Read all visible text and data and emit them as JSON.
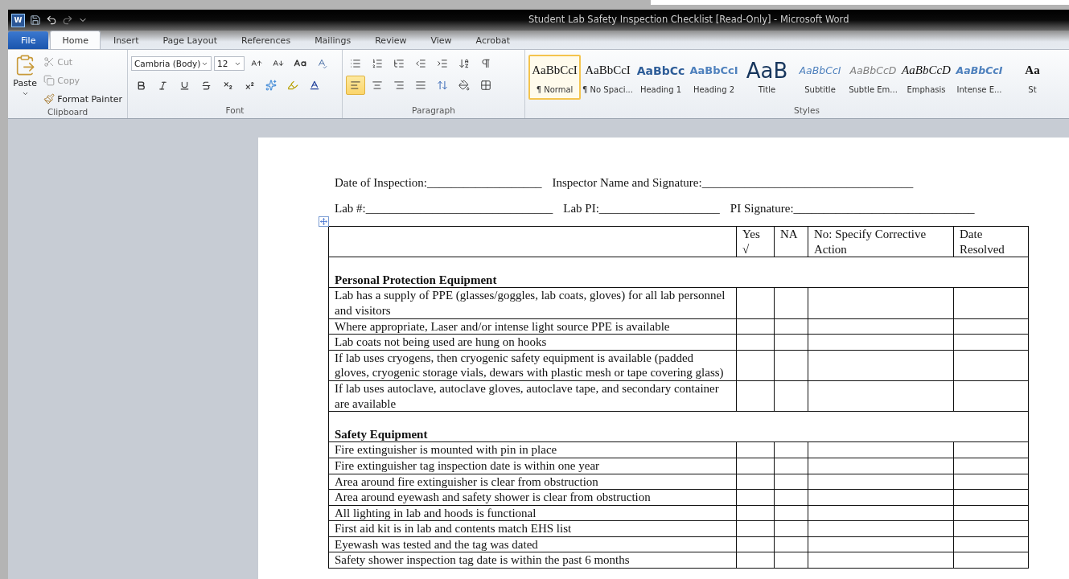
{
  "window": {
    "app_icon": "W",
    "title": "Student Lab Safety Inspection Checklist [Read-Only]  -  Microsoft Word"
  },
  "tabs": [
    {
      "label": "File",
      "kind": "file",
      "selected": false
    },
    {
      "label": "Home",
      "kind": "tab",
      "selected": true
    },
    {
      "label": "Insert",
      "kind": "tab",
      "selected": false
    },
    {
      "label": "Page Layout",
      "kind": "tab",
      "selected": false
    },
    {
      "label": "References",
      "kind": "tab",
      "selected": false
    },
    {
      "label": "Mailings",
      "kind": "tab",
      "selected": false
    },
    {
      "label": "Review",
      "kind": "tab",
      "selected": false
    },
    {
      "label": "View",
      "kind": "tab",
      "selected": false
    },
    {
      "label": "Acrobat",
      "kind": "tab",
      "selected": false
    }
  ],
  "clipboard": {
    "group": "Clipboard",
    "paste": "Paste",
    "cut": "Cut",
    "copy": "Copy",
    "format_painter": "Format Painter"
  },
  "font": {
    "group": "Font",
    "name": "Cambria (Body)",
    "size": "12"
  },
  "paragraph": {
    "group": "Paragraph",
    "alignments": [
      {
        "kind": "left",
        "selected": true
      },
      {
        "kind": "center",
        "selected": false
      },
      {
        "kind": "right",
        "selected": false
      },
      {
        "kind": "justify",
        "selected": false
      }
    ]
  },
  "styles": {
    "group": "Styles",
    "items": [
      {
        "kind": "normal",
        "sample": "AaBbCcI",
        "label": "¶ Normal",
        "selected": true
      },
      {
        "kind": "normal",
        "sample": "AaBbCcI",
        "label": "¶ No Spaci...",
        "selected": false
      },
      {
        "kind": "heading1",
        "sample": "AaBbCc",
        "label": "Heading 1",
        "selected": false
      },
      {
        "kind": "heading2",
        "sample": "AaBbCcI",
        "label": "Heading 2",
        "selected": false
      },
      {
        "kind": "title",
        "sample": "AaB",
        "label": "Title",
        "selected": false
      },
      {
        "kind": "subtitle",
        "sample": "AaBbCcI",
        "label": "Subtitle",
        "selected": false
      },
      {
        "kind": "subtle",
        "sample": "AaBbCcD",
        "label": "Subtle Em...",
        "selected": false
      },
      {
        "kind": "emphasis",
        "sample": "AaBbCcD",
        "label": "Emphasis",
        "selected": false
      },
      {
        "kind": "intense",
        "sample": "AaBbCcI",
        "label": "Intense E...",
        "selected": false
      },
      {
        "kind": "strong",
        "sample": "Aa",
        "label": "St",
        "selected": false
      }
    ]
  },
  "document": {
    "fields": [
      [
        {
          "label": "Date of Inspection: ",
          "line": "___________________"
        },
        {
          "label": "Inspector Name and Signature:",
          "line": "___________________________________"
        }
      ],
      [
        {
          "label": "Lab #:",
          "line": "_______________________________"
        },
        {
          "label": "Lab PI: ",
          "line": "____________________"
        },
        {
          "label": "PI Signature: ",
          "line": "______________________________"
        }
      ]
    ],
    "table": {
      "columns": [
        "",
        "Yes √",
        "NA",
        "No: Specify Corrective Action",
        "Date Resolved"
      ],
      "sections": [
        {
          "title": "Personal Protection Equipment",
          "items": [
            "Lab has a supply of PPE  (glasses/goggles, lab coats, gloves) for all lab personnel and visitors",
            "Where appropriate, Laser and/or intense light source PPE is available",
            "Lab coats not being used are hung on hooks",
            "If lab uses cryogens, then cryogenic safety equipment is available (padded gloves, cryogenic storage vials, dewars with plastic mesh or tape covering glass)",
            "If lab uses autoclave, autoclave gloves, autoclave tape, and secondary container are available"
          ]
        },
        {
          "title": "Safety Equipment",
          "items": [
            "Fire extinguisher is mounted with  pin in place",
            "Fire extinguisher tag inspection date is within  one year",
            "Area around fire extinguisher is clear from obstruction",
            "Area around eyewash and safety shower is clear from obstruction",
            "All lighting in lab and hoods is functional",
            "First aid kit is in lab and contents match EHS list",
            "Eyewash was tested and the tag was dated",
            "Safety shower inspection tag date is within the past 6 months"
          ]
        }
      ]
    }
  }
}
